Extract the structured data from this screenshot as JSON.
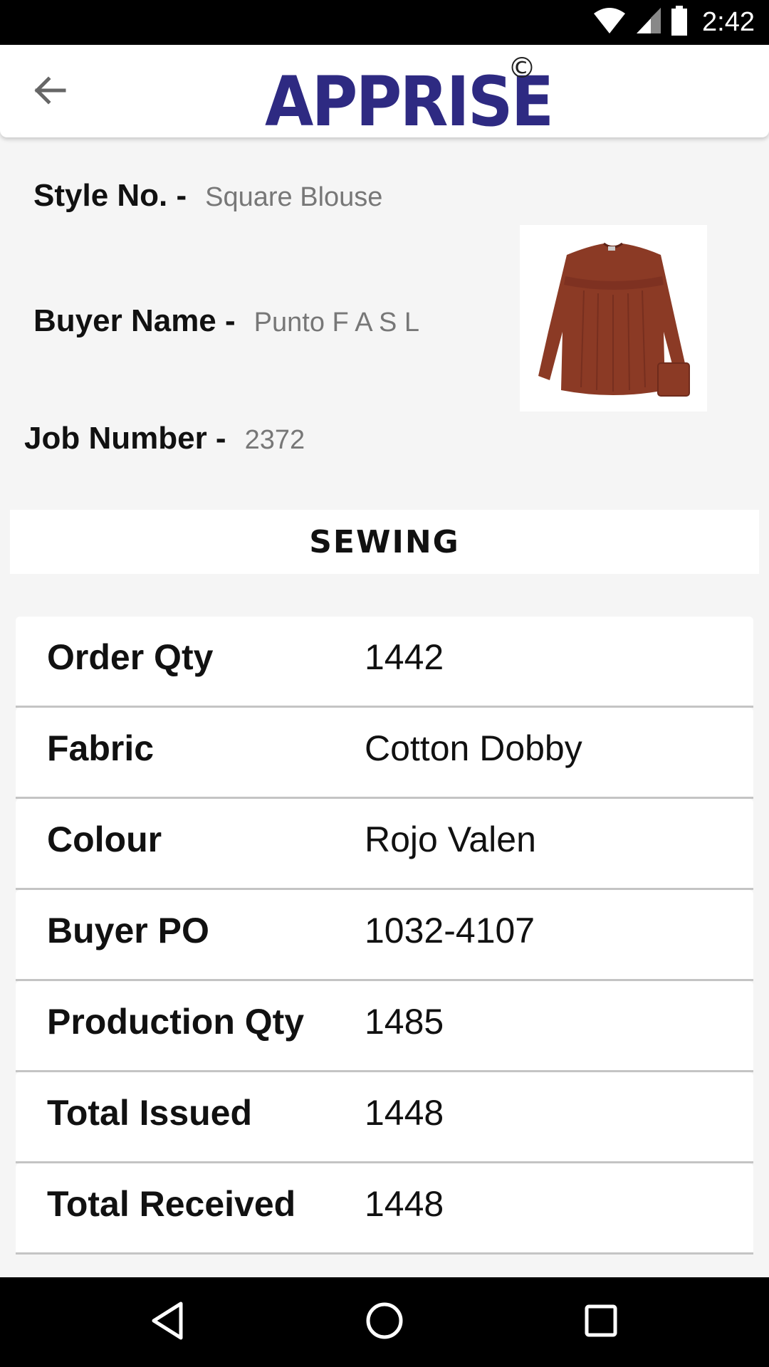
{
  "status_bar": {
    "time": "2:42",
    "icons": [
      "wifi-icon",
      "signal-icon",
      "battery-icon"
    ]
  },
  "app_bar": {
    "back_icon": "arrow-back-icon",
    "logo_text": "APPRISE",
    "logo_mark": "©"
  },
  "info": {
    "style_label": "Style No. -",
    "style_value": "Square Blouse",
    "buyer_label": "Buyer Name -",
    "buyer_value": "Punto F A S L",
    "job_label": "Job Number -",
    "job_value": "2372"
  },
  "section": {
    "title": "SEWING"
  },
  "details": [
    {
      "label": "Order Qty",
      "value": "1442"
    },
    {
      "label": "Fabric",
      "value": "Cotton Dobby"
    },
    {
      "label": "Colour",
      "value": "Rojo Valen"
    },
    {
      "label": "Buyer PO",
      "value": "1032-4107"
    },
    {
      "label": "Production Qty",
      "value": "1485"
    },
    {
      "label": "Total Issued",
      "value": "1448"
    },
    {
      "label": "Total Received",
      "value": "1448"
    }
  ],
  "nav_bar": {
    "icons": [
      "back-triangle-icon",
      "home-circle-icon",
      "recents-square-icon"
    ]
  },
  "colors": {
    "brand": "#2e2a82",
    "blouse": "#8b3a25",
    "background": "#f5f5f5"
  }
}
